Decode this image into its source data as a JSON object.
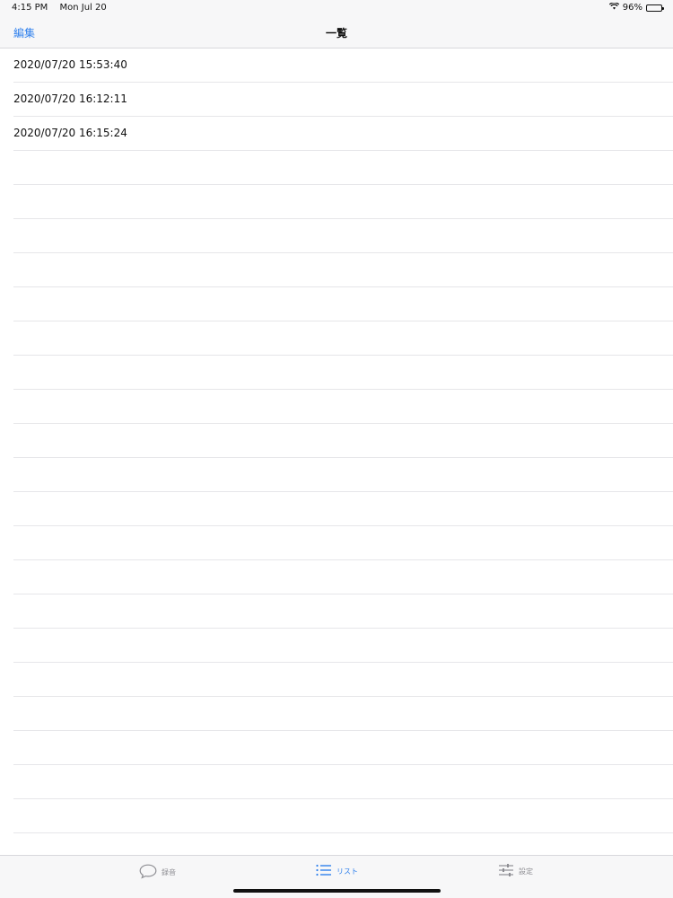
{
  "status_bar": {
    "time": "4:15 PM",
    "date": "Mon Jul 20",
    "battery_percent": "96%",
    "battery_level": 0.96,
    "wifi_icon": "wifi-icon"
  },
  "nav": {
    "edit_label": "編集",
    "title": "一覧"
  },
  "list": {
    "items": [
      {
        "label": "2020/07/20 15:53:40"
      },
      {
        "label": "2020/07/20 16:12:11"
      },
      {
        "label": "2020/07/20 16:15:24"
      }
    ]
  },
  "tabs": [
    {
      "label": "録音",
      "icon": "speech-bubble-icon",
      "active": false
    },
    {
      "label": "リスト",
      "icon": "list-icon",
      "active": true
    },
    {
      "label": "設定",
      "icon": "sliders-icon",
      "active": false
    }
  ],
  "colors": {
    "accent": "#2f80ed",
    "inactive_tab": "#8e8e93",
    "bar_background": "#f7f7f8",
    "separator": "#e6e6e9"
  }
}
